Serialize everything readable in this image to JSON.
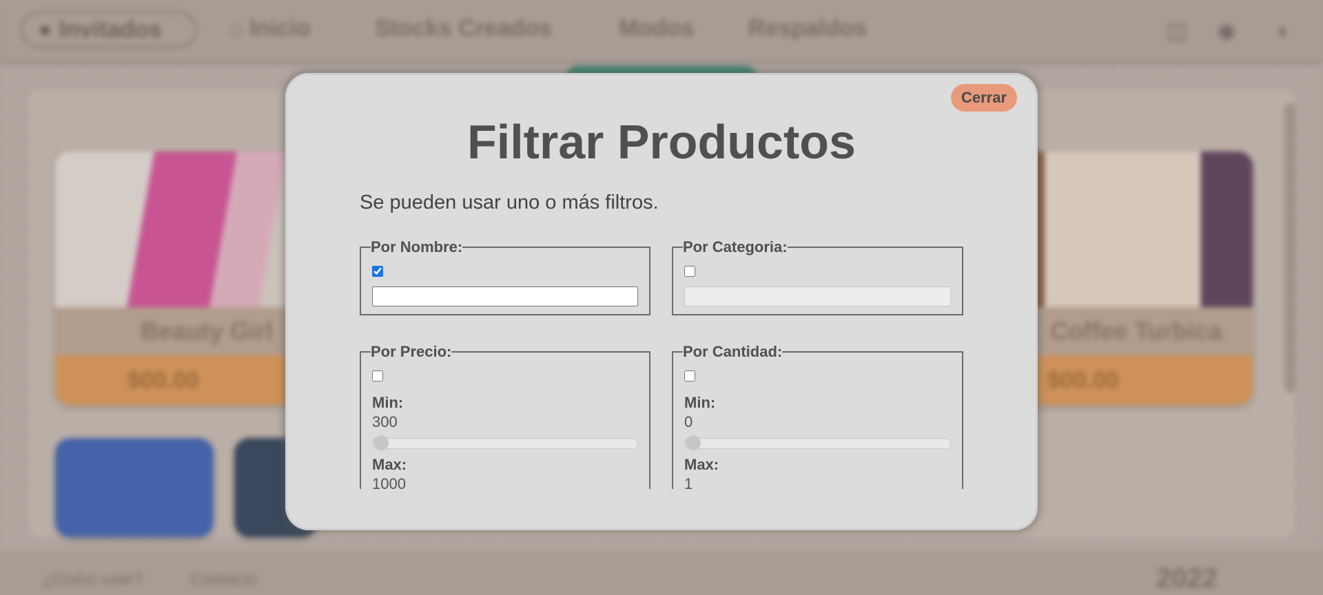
{
  "background": {
    "nav": {
      "guest_label": "Invitados",
      "links": [
        "Inicio",
        "Stocks Creados",
        "Modos",
        "Respaldos"
      ]
    },
    "cards": [
      {
        "name": "Beauty Girl",
        "price": "$00.00"
      },
      {
        "name": "Coffee Turbica",
        "price": "$00.00"
      }
    ],
    "footer": {
      "link1": "¿Como usar?",
      "link2": "Contacto",
      "year": "2022"
    }
  },
  "modal": {
    "close_label": "Cerrar",
    "title": "Filtrar Productos",
    "subtitle": "Se pueden usar uno o más filtros.",
    "filters": {
      "name": {
        "legend": "Por Nombre:",
        "checked": true,
        "value": ""
      },
      "category": {
        "legend": "Por Categoria:",
        "checked": false,
        "value": ""
      },
      "price": {
        "legend": "Por Precio:",
        "checked": false,
        "min_label": "Min:",
        "min_value": "300",
        "min_fraction": 0,
        "max_label": "Max:",
        "max_value": "1000"
      },
      "quantity": {
        "legend": "Por Cantidad:",
        "checked": false,
        "min_label": "Min:",
        "min_value": "0",
        "min_fraction": 0,
        "max_label": "Max:",
        "max_value": "1"
      }
    }
  },
  "colors": {
    "close_button": "#e89a7a",
    "checkbox_accent": "#1a73e8",
    "price_bar": "#e19a55",
    "green_tab": "#2f8a72"
  }
}
